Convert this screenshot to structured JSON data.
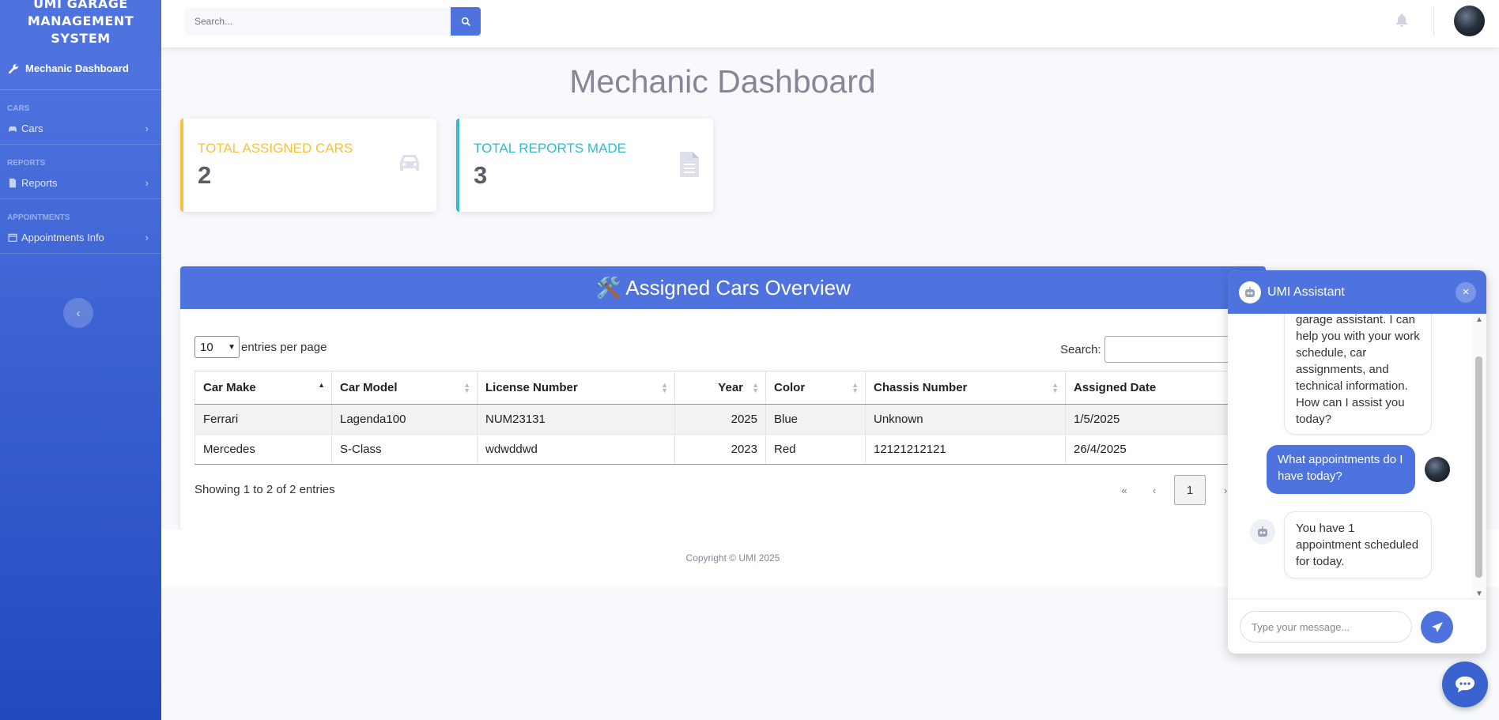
{
  "sidebar": {
    "brand_lines": [
      "UMI GARAGE",
      "MANAGEMENT",
      "SYSTEM"
    ],
    "active_item": "Mechanic Dashboard",
    "sections": [
      {
        "heading": "CARS",
        "item": "Cars"
      },
      {
        "heading": "REPORTS",
        "item": "Reports"
      },
      {
        "heading": "APPOINTMENTS",
        "item": "Appointments Info"
      }
    ]
  },
  "topbar": {
    "search_placeholder": "Search..."
  },
  "page": {
    "title": "Mechanic Dashboard"
  },
  "cards": [
    {
      "label": "TOTAL ASSIGNED CARS",
      "value": "2",
      "color": "#f6c23e",
      "icon": "car-icon"
    },
    {
      "label": "TOTAL REPORTS MADE",
      "value": "3",
      "color": "#36b9cc",
      "icon": "file-icon"
    }
  ],
  "table": {
    "title_icon": "🛠️",
    "title": "Assigned Cars Overview",
    "page_size": "10",
    "entries_label": "entries per page",
    "search_label": "Search:",
    "columns": [
      "Car Make",
      "Car Model",
      "License Number",
      "Year",
      "Color",
      "Chassis Number",
      "Assigned Date"
    ],
    "rows": [
      [
        "Ferrari",
        "Lagenda100",
        "NUM23131",
        "2025",
        "Blue",
        "Unknown",
        "1/5/2025"
      ],
      [
        "Mercedes",
        "S-Class",
        "wdwddwd",
        "2023",
        "Red",
        "12121212121",
        "26/4/2025"
      ]
    ],
    "showing": "Showing 1 to 2 of 2 entries",
    "pager": {
      "first": "«",
      "prev": "‹",
      "current": "1",
      "next": "›"
    }
  },
  "footer": {
    "copyright": "Copyright © UMI 2025"
  },
  "chat": {
    "title": "UMI Assistant",
    "close": "×",
    "messages": [
      {
        "from": "bot",
        "text": "garage assistant. I can help you with your work schedule, car assignments, and technical information. How can I assist you today?"
      },
      {
        "from": "user",
        "text": "What appointments do I have today?"
      },
      {
        "from": "bot",
        "text": "You have 1 appointment scheduled for today."
      }
    ],
    "input_placeholder": "Type your message..."
  },
  "colors": {
    "primary": "#4e73df",
    "warning": "#f6c23e",
    "info": "#36b9cc"
  }
}
